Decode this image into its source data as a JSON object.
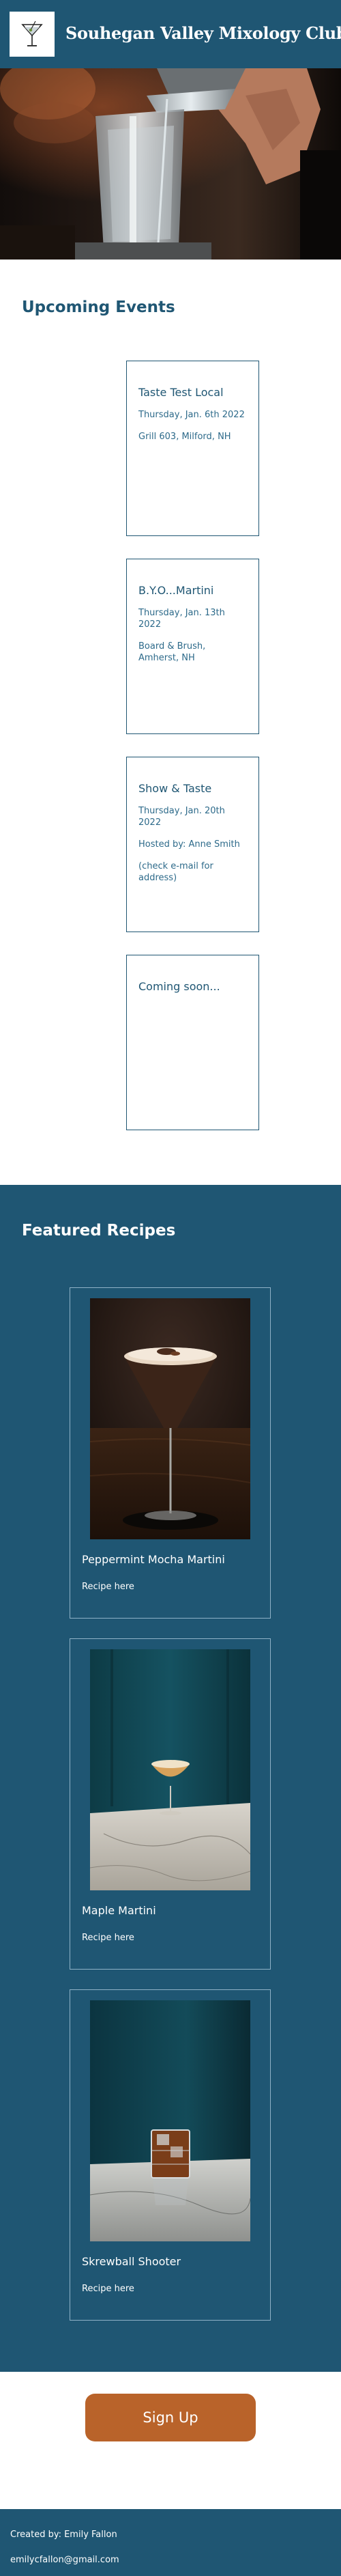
{
  "header": {
    "title": "Souhegan Valley Mixology Club",
    "logo_icon": "martini-glass-icon"
  },
  "hero": {
    "image": "bartender-pouring-cocktail-photo"
  },
  "events": {
    "heading": "Upcoming Events",
    "items": [
      {
        "title": "Taste Test Local",
        "date": "Thursday, Jan. 6th 2022",
        "location": "Grill 603, Milford, NH"
      },
      {
        "title": "B.Y.O...Martini",
        "date": "Thursday, Jan. 13th 2022",
        "location": "Board & Brush, Amherst, NH"
      },
      {
        "title": "Show & Taste",
        "date": "Thursday, Jan. 20th 2022",
        "host": "Hosted by: Anne Smith",
        "note": "(check e-mail for address)"
      },
      {
        "title": "Coming soon..."
      }
    ]
  },
  "recipes": {
    "heading": "Featured Recipes",
    "items": [
      {
        "name": "Peppermint Mocha Martini",
        "link_text": "Recipe here",
        "image": "peppermint-mocha-martini-photo"
      },
      {
        "name": "Maple Martini",
        "link_text": "Recipe here",
        "image": "maple-martini-photo"
      },
      {
        "name": "Skrewball Shooter",
        "link_text": "Recipe here",
        "image": "skrewball-shooter-photo"
      }
    ]
  },
  "signup": {
    "label": "Sign Up"
  },
  "footer": {
    "credit": "Created by: Emily Fallon",
    "email": "emilycfallon@gmail.com"
  },
  "colors": {
    "primary": "#1f5673",
    "accent": "#b9632a",
    "card_border_light": "#8fb2c7",
    "background": "#ffffff"
  }
}
